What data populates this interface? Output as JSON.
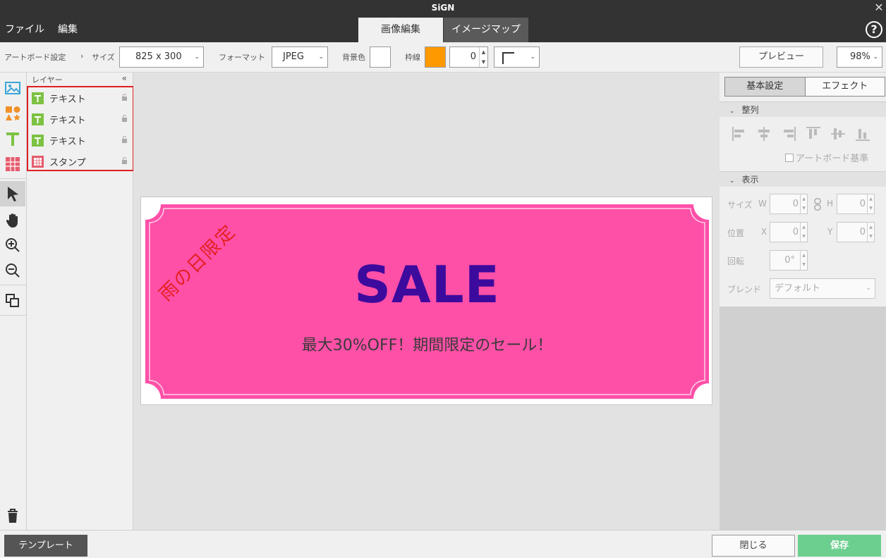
{
  "window": {
    "title": "SiGN"
  },
  "menu": {
    "file": "ファイル",
    "edit": "編集"
  },
  "tabs": {
    "image_edit": "画像編集",
    "image_map": "イメージマップ"
  },
  "toolbar": {
    "artboard_label": "アートボード設定",
    "size_label": "サイズ",
    "size_value": "825 x 300",
    "format_label": "フォーマット",
    "format_value": "JPEG",
    "bg_label": "背景色",
    "bg_color": "#ffffff",
    "border_label": "枠線",
    "border_color": "#ff9900",
    "border_width": "0",
    "preview": "プレビュー",
    "zoom": "98%"
  },
  "layers": {
    "header": "レイヤー",
    "collapse": "«",
    "items": [
      {
        "name": "テキスト",
        "type": "text"
      },
      {
        "name": "テキスト",
        "type": "text"
      },
      {
        "name": "テキスト",
        "type": "text"
      },
      {
        "name": "スタンプ",
        "type": "stamp"
      }
    ]
  },
  "artboard": {
    "headline": "SALE",
    "subline": "最大30%OFF！期間限定のセール！",
    "tag": "雨の日限定",
    "panel_color": "#ff50a8",
    "headline_color": "#3d0a9e",
    "tag_color": "#e42020"
  },
  "props": {
    "tab_basic": "基本設定",
    "tab_effect": "エフェクト",
    "align_header": "整列",
    "artboard_ref": "アートボード基準",
    "display_header": "表示",
    "size_label": "サイズ",
    "w_label": "W",
    "h_label": "H",
    "w_value": "0",
    "h_value": "0",
    "pos_label": "位置",
    "x_label": "X",
    "y_label": "Y",
    "x_value": "0",
    "y_value": "0",
    "rotate_label": "回転",
    "rotate_value": "0°",
    "blend_label": "ブレンド",
    "blend_value": "デフォルト"
  },
  "bottom": {
    "template": "テンプレート",
    "close": "閉じる",
    "save": "保存"
  }
}
